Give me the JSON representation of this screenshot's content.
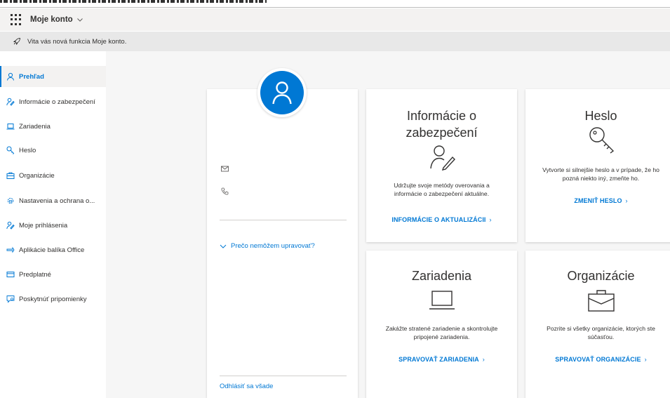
{
  "header": {
    "app_title": "Moje konto"
  },
  "notice": {
    "text": "Vita vás nová funkcia Moje konto."
  },
  "sidebar": {
    "items": [
      {
        "label": "Prehľad",
        "icon": "person-icon",
        "active": true
      },
      {
        "label": "Informácie o zabezpečení",
        "icon": "person-key-icon"
      },
      {
        "label": "Zariadenia",
        "icon": "laptop-icon"
      },
      {
        "label": "Heslo",
        "icon": "key-icon"
      },
      {
        "label": "Organizácie",
        "icon": "briefcase-icon"
      },
      {
        "label": "Nastavenia a ochrana o...",
        "icon": "gear-lock-icon"
      },
      {
        "label": "Moje prihlásenia",
        "icon": "person-key-icon"
      },
      {
        "label": "Aplikácie balíka Office",
        "icon": "apps-icon"
      },
      {
        "label": "Predplatné",
        "icon": "card-icon"
      },
      {
        "label": "Poskytnúť pripomienky",
        "icon": "feedback-icon"
      }
    ]
  },
  "profile": {
    "why_link": "Prečo nemôžem upravovať?",
    "signout": "Odhlásiť sa všade"
  },
  "tiles": {
    "security": {
      "title_line1": "Informácie o",
      "title_line2": "zabezpečení",
      "desc_line1": "Udržujte svoje metódy overovania a",
      "desc_line2": "informácie o zabezpečení aktuálne.",
      "link": "INFORMÁCIE O AKTUALIZÁCII"
    },
    "password": {
      "title": "Heslo",
      "desc_line1": "Vytvorte si silnejšie heslo a v prípade, že ho",
      "desc_line2": "pozná niekto iný, zmeňte ho.",
      "link": "ZMENIŤ HESLO"
    },
    "devices": {
      "title": "Zariadenia",
      "desc_line1": "Zakážte stratené zariadenie a skontrolujte",
      "desc_line2": "pripojené zariadenia.",
      "link": "SPRAVOVAŤ ZARIADENIA"
    },
    "organizations": {
      "title": "Organizácie",
      "desc_line1": "Pozrite si všetky organizácie, ktorých ste",
      "desc_line2": "súčasťou.",
      "link": "SPRAVOVAŤ ORGANIZÁCIE"
    }
  },
  "colors": {
    "accent": "#0078d4",
    "header_bg": "#f3f2f1",
    "notice_bg": "#e8e8e8",
    "main_bg": "#f6f6f6"
  }
}
